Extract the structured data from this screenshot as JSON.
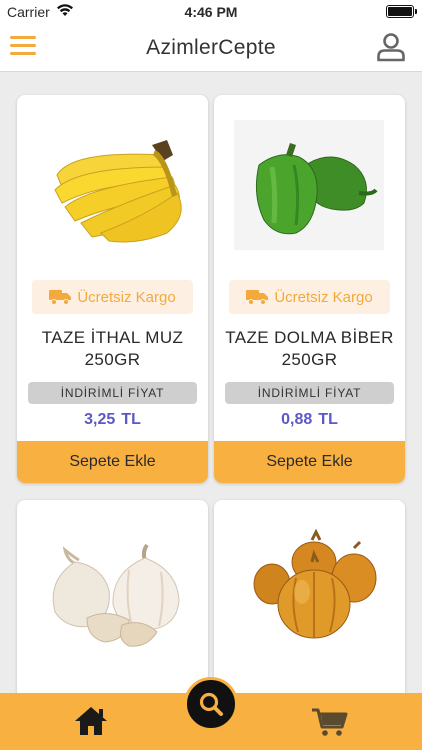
{
  "status_bar": {
    "carrier": "Carrier",
    "time": "4:46 PM"
  },
  "nav": {
    "title": "AzimlerCepte",
    "menu_icon": "hamburger-icon",
    "profile_icon": "user-icon"
  },
  "products": [
    {
      "name": "TAZE İTHAL MUZ 250GR",
      "badge": "Ücretsiz Kargo",
      "discount_label": "İNDİRİMLİ FİYAT",
      "price": "3,25",
      "currency": "TL",
      "button": "Sepete Ekle",
      "image": "banana"
    },
    {
      "name": "TAZE DOLMA BİBER 250GR",
      "badge": "Ücretsiz Kargo",
      "discount_label": "İNDİRİMLİ FİYAT",
      "price": "0,88",
      "currency": "TL",
      "button": "Sepete Ekle",
      "image": "green-pepper"
    },
    {
      "image": "garlic"
    },
    {
      "image": "onion"
    }
  ],
  "tab_bar": {
    "home_icon": "home-icon",
    "search_icon": "search-icon",
    "cart_icon": "cart-icon"
  },
  "colors": {
    "accent": "#f8b040",
    "price": "#5b58c8",
    "badge_bg": "#fdf0e2"
  }
}
